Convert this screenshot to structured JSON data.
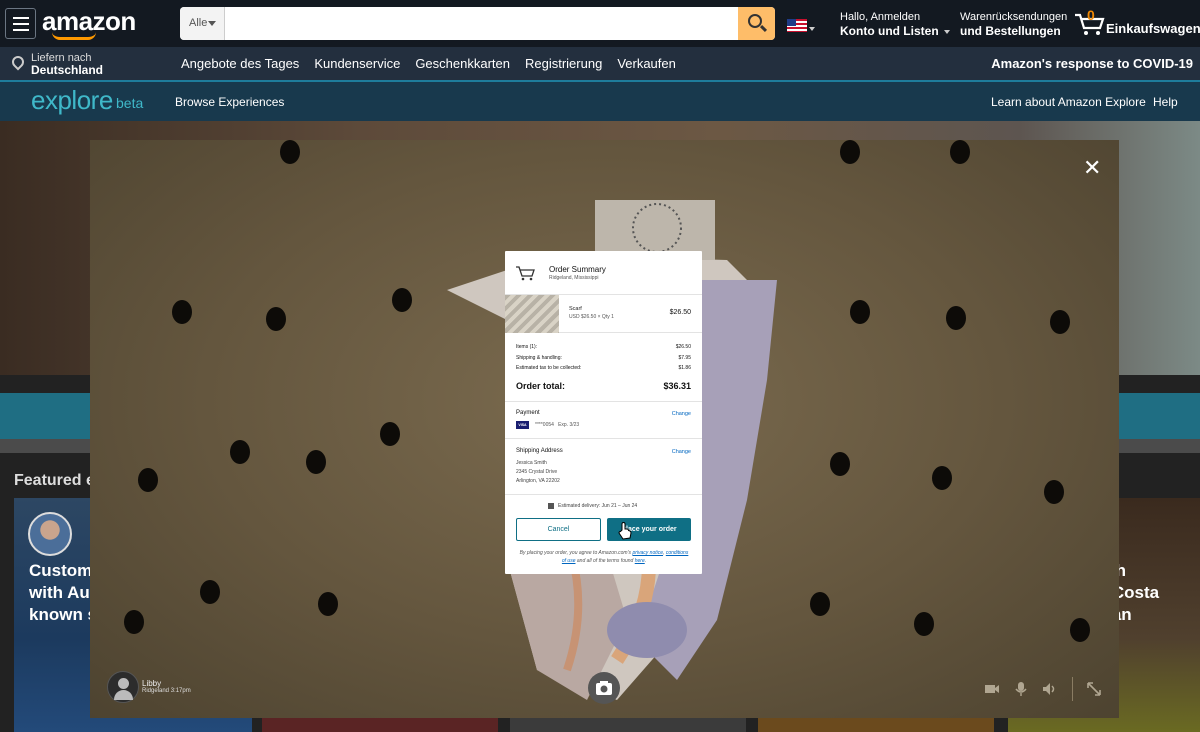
{
  "header": {
    "logo_text": "amazon",
    "search": {
      "category": "Alle",
      "placeholder": "",
      "value": ""
    },
    "account": {
      "line1": "Hallo, Anmelden",
      "line2": "Konto und Listen"
    },
    "returns": {
      "line1": "Warenrücksendungen",
      "line2": "und Bestellungen"
    },
    "cart": {
      "count": "0",
      "label": "Einkaufswagen"
    },
    "accent": "#febd69"
  },
  "subnav": {
    "deliver_line1": "Liefern nach",
    "deliver_line2": "Deutschland",
    "links": [
      "Angebote des Tages",
      "Kundenservice",
      "Geschenkkarten",
      "Registrierung",
      "Verkaufen"
    ],
    "covid": "Amazon's response to COVID-19"
  },
  "explore": {
    "logo": "explore",
    "beta": "beta",
    "browse": "Browse Experiences",
    "learn": "Learn about Amazon Explore",
    "help": "Help"
  },
  "background": {
    "featured": "Featured ex",
    "card_left_text": "Customi\nwith Aus\nknown s",
    "card_right_text": "with\nin Costa\nucan\nn"
  },
  "modal": {
    "presenter_name": "Libby",
    "presenter_meta": "Ridgeland 3:17pm"
  },
  "order": {
    "title": "Order Summary",
    "location": "Ridgeland, Mississippi",
    "item": {
      "name": "Scarf",
      "detail": "USD $26.50 × Qty 1",
      "price": "$26.50"
    },
    "totals": [
      {
        "label": "Items (1):",
        "value": "$26.50"
      },
      {
        "label": "Shipping & handling:",
        "value": "$7.95"
      },
      {
        "label": "Estimated tax to be collected:",
        "value": "$1.86"
      }
    ],
    "order_total_label": "Order total:",
    "order_total_value": "$36.31",
    "payment_title": "Payment",
    "change_label": "Change",
    "card_brand": "VISA",
    "card_number": "****0054",
    "card_exp": "Exp. 3/23",
    "shipping_title": "Shipping Address",
    "address": [
      "Jessica Smith",
      "2345 Crystal Drive",
      "Arlington, VA 22202"
    ],
    "estimated_delivery": "Estimated delivery: Jun 21 – Jun 24",
    "cancel_label": "Cancel",
    "place_label": "Place your order",
    "fine_pre": "By placing your order, you agree to Amazon.com's",
    "privacy": "privacy notice",
    "conditions": "conditions of use",
    "fine_mid": "and all of the terms found",
    "here": "here",
    "accent": "#0f6f85"
  }
}
